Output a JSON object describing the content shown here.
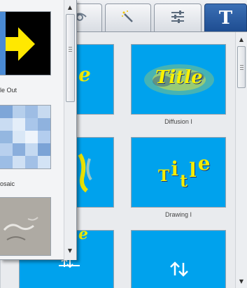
{
  "tabs": [
    {
      "name": "eye-tab",
      "icon": "eye-icon",
      "active": false
    },
    {
      "name": "magic-wand-tab",
      "icon": "magic-wand-icon",
      "active": false
    },
    {
      "name": "sliders-tab",
      "icon": "sliders-icon",
      "active": false
    },
    {
      "name": "title-tab",
      "icon": "title-t-icon",
      "label": "T",
      "active": true
    }
  ],
  "gallery": {
    "items": [
      {
        "title": "Title",
        "caption": "Diffusion I"
      },
      {
        "title": "Title",
        "caption": "Drawing I"
      }
    ]
  },
  "transitions": {
    "items": [
      {
        "label": "le Out"
      },
      {
        "label": "osaic"
      }
    ]
  },
  "colors": {
    "thumbnail_blue": "#00a2ed",
    "title_yellow": "#f2ea00",
    "active_tab": "#2a5ba0"
  }
}
